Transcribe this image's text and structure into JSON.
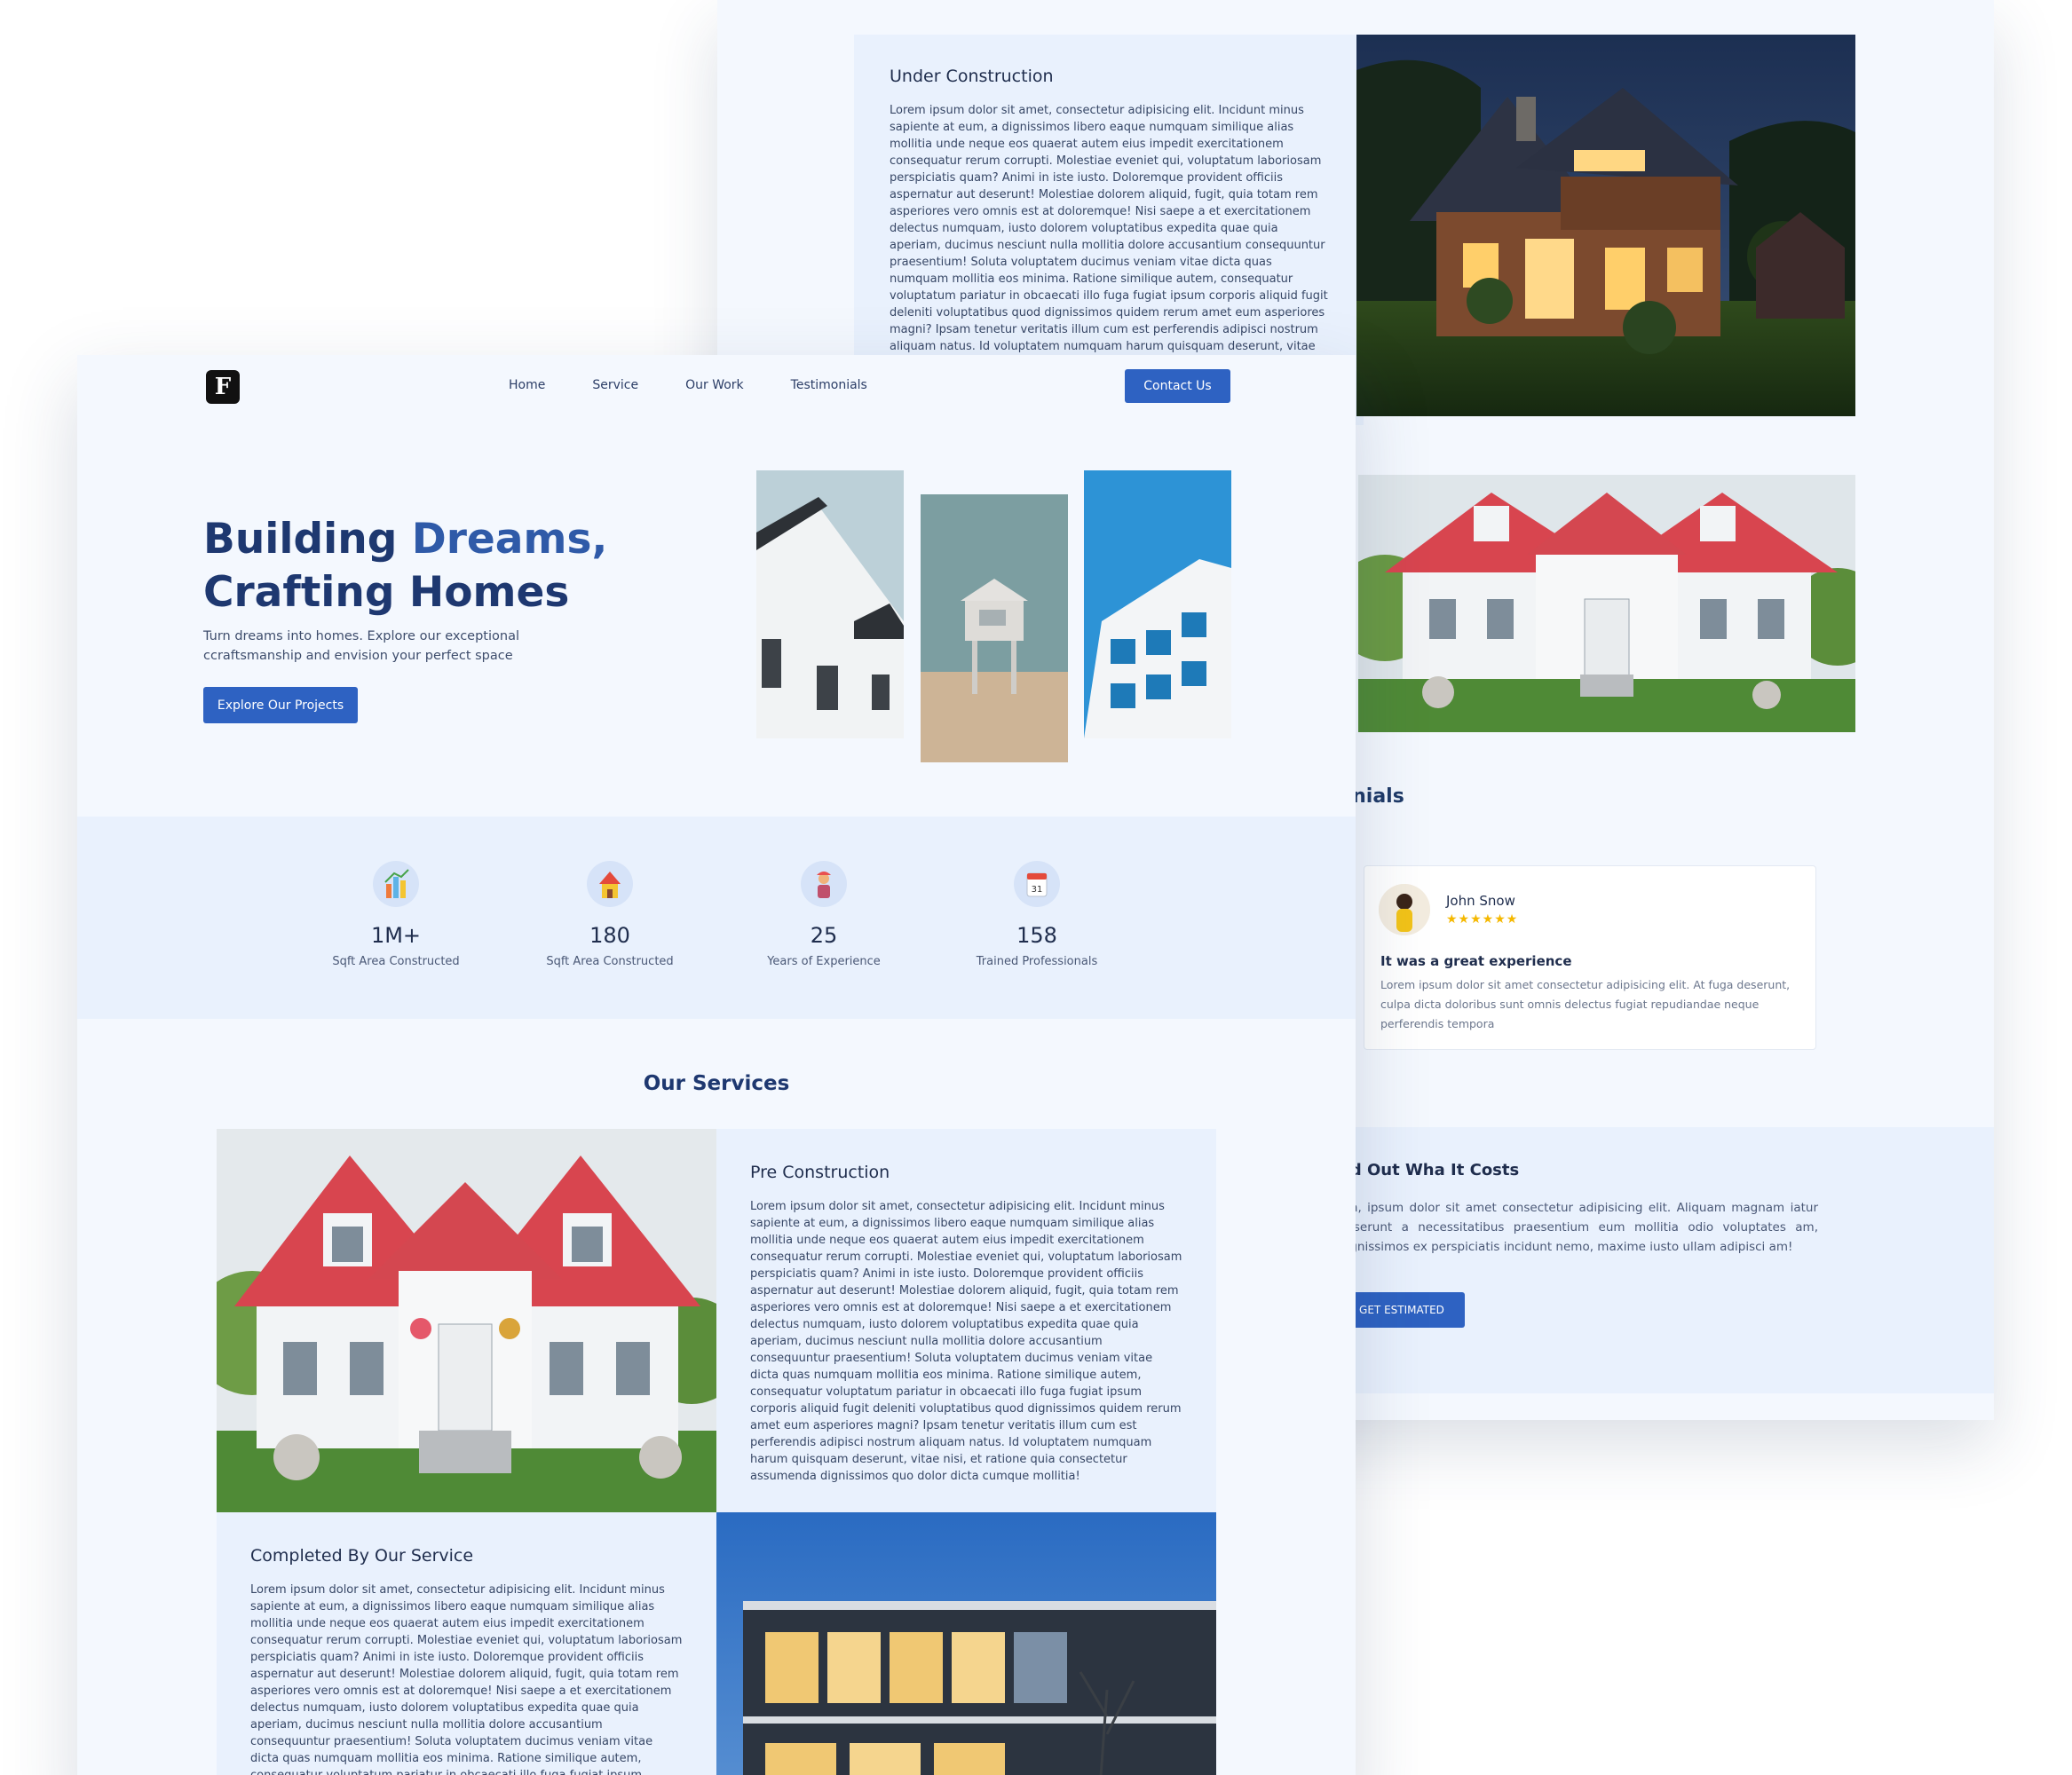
{
  "colors": {
    "primary": "#2e62c2",
    "heading": "#1e3870",
    "background": "#f4f8fe",
    "panel": "#e9f1fd",
    "star": "#f5b800"
  },
  "back": {
    "under_construction": {
      "title": "Under Construction",
      "text": "Lorem ipsum dolor sit amet, consectetur adipisicing elit. Incidunt minus sapiente at eum, a dignissimos libero eaque numquam similique alias mollitia unde neque eos quaerat autem eius impedit exercitationem consequatur rerum corrupti. Molestiae eveniet qui, voluptatum laboriosam perspiciatis quam? Animi in iste iusto. Doloremque provident officiis aspernatur aut deserunt! Molestiae dolorem aliquid, fugit, quia totam rem asperiores vero omnis est at doloremque! Nisi saepe a et exercitationem delectus numquam, iusto dolorem voluptatibus expedita quae quia aperiam, ducimus nesciunt nulla mollitia dolore accusantium consequuntur praesentium! Soluta voluptatem ducimus veniam vitae dicta quas numquam mollitia eos minima. Ratione similique autem, consequatur voluptatum pariatur in obcaecati illo fuga fugiat ipsum corporis aliquid fugit deleniti voluptatibus quod dignissimos quidem rerum amet eum asperiores magni? Ipsam tenetur veritatis illum cum est perferendis adipisci nostrum aliquam natus. Id voluptatem numquam harum quisquam deserunt, vitae nisi, et ratione quia consectetur"
    },
    "testimonials_title": "onials",
    "testimonial": {
      "name": "John Snow",
      "stars": "★★★★★★",
      "title": "It was a great experience",
      "text": "Lorem ipsum dolor sit amet consectetur adipisicing elit. At fuga deserunt, culpa dicta doloribus sunt omnis delectus fugiat repudiandae neque perferendis tempora"
    },
    "cost": {
      "title": "nd Out Wha It Costs",
      "text": "em, ipsum dolor sit amet consectetur adipisicing elit. Aliquam magnam iatur deserunt a necessitatibus praesentium eum mollitia odio voluptates am, dignissimos ex perspiciatis incidunt nemo, maxime iusto ullam adipisci am!",
      "button": "GET ESTIMATED"
    }
  },
  "front": {
    "logo": "F",
    "nav": [
      "Home",
      "Service",
      "Our Work",
      "Testimonials"
    ],
    "contact_button": "Contact Us",
    "hero": {
      "title_line1_a": "Building ",
      "title_line1_b": "Dreams,",
      "title_line2": "Crafting Homes",
      "subtitle": "Turn dreams into homes. Explore our exceptional ccraftsmanship and envision your perfect space",
      "button": "Explore Our Projects"
    },
    "stats": [
      {
        "icon": "bar-chart-icon",
        "value": "1M+",
        "label": "Sqft Area Constructed"
      },
      {
        "icon": "house-icon",
        "value": "180",
        "label": "Sqft Area Constructed"
      },
      {
        "icon": "worker-icon",
        "value": "25",
        "label": "Years of Experience"
      },
      {
        "icon": "calendar-icon",
        "value": "158",
        "label": "Trained Professionals"
      }
    ],
    "services_title": "Our Services",
    "services": [
      {
        "title": "Pre Construction",
        "text": "Lorem ipsum dolor sit amet, consectetur adipisicing elit. Incidunt minus sapiente at eum, a dignissimos libero eaque numquam similique alias mollitia unde neque eos quaerat autem eius impedit exercitationem consequatur rerum corrupti. Molestiae eveniet qui, voluptatum laboriosam perspiciatis quam? Animi in iste iusto. Doloremque provident officiis aspernatur aut deserunt! Molestiae dolorem aliquid, fugit, quia totam rem asperiores vero omnis est at doloremque! Nisi saepe a et exercitationem delectus numquam, iusto dolorem voluptatibus expedita quae quia aperiam, ducimus nesciunt nulla mollitia dolore accusantium consequuntur praesentium! Soluta voluptatem ducimus veniam vitae dicta quas numquam mollitia eos minima. Ratione similique autem, consequatur voluptatum pariatur in obcaecati illo fuga fugiat ipsum corporis aliquid fugit deleniti voluptatibus quod dignissimos quidem rerum amet eum asperiores magni? Ipsam tenetur veritatis illum cum est perferendis adipisci nostrum aliquam natus. Id voluptatem numquam harum quisquam deserunt, vitae nisi, et ratione quia consectetur assumenda dignissimos quo dolor dicta cumque mollitia!"
      },
      {
        "title": "Completed By Our Service",
        "text": "Lorem ipsum dolor sit amet, consectetur adipisicing elit. Incidunt minus sapiente at eum, a dignissimos libero eaque numquam similique alias mollitia unde neque eos quaerat autem eius impedit exercitationem consequatur rerum corrupti. Molestiae eveniet qui, voluptatum laboriosam perspiciatis quam? Animi in iste iusto. Doloremque provident officiis aspernatur aut deserunt! Molestiae dolorem aliquid, fugit, quia totam rem asperiores vero omnis est at doloremque! Nisi saepe a et exercitationem delectus numquam, iusto dolorem voluptatibus expedita quae quia aperiam, ducimus nesciunt nulla mollitia dolore accusantium consequuntur praesentium! Soluta voluptatem ducimus veniam vitae dicta quas numquam mollitia eos minima. Ratione similique autem, consequatur voluptatum pariatur in obcaecati illo fuga fugiat ipsum"
      }
    ]
  }
}
